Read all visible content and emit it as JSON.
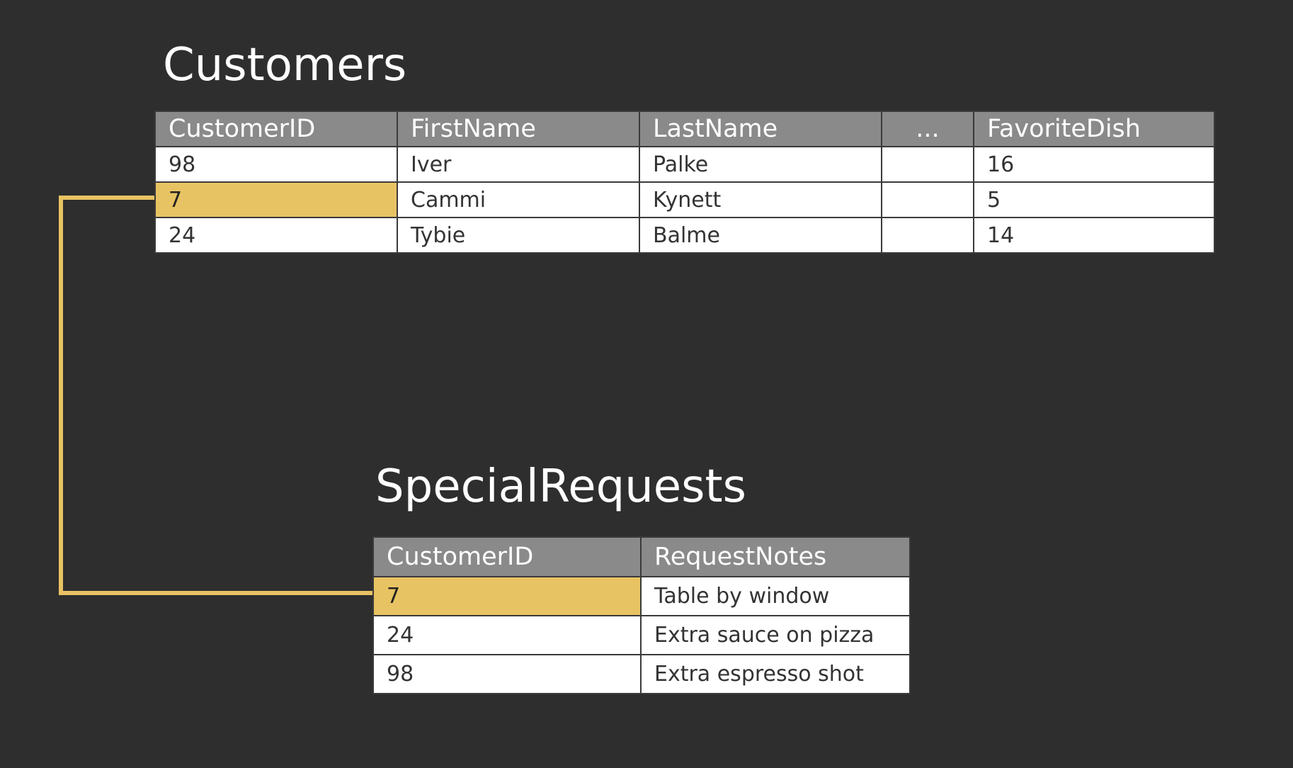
{
  "customers": {
    "title": "Customers",
    "columns": [
      "CustomerID",
      "FirstName",
      "LastName",
      "...",
      "FavoriteDish"
    ],
    "rows": [
      [
        "98",
        "Iver",
        "Palke",
        "",
        "16"
      ],
      [
        "7",
        "Cammi",
        "Kynett",
        "",
        "5"
      ],
      [
        "24",
        "Tybie",
        "Balme",
        "",
        "14"
      ]
    ]
  },
  "special_requests": {
    "title": "SpecialRequests",
    "columns": [
      "CustomerID",
      "RequestNotes"
    ],
    "rows": [
      [
        "7",
        "Table by window"
      ],
      [
        "24",
        "Extra sauce on pizza"
      ],
      [
        "98",
        "Extra espresso shot"
      ]
    ]
  },
  "colors": {
    "background": "#2e2e2e",
    "header": "#8a8a8a",
    "highlight": "#e8c363",
    "connector": "#e8c363"
  }
}
